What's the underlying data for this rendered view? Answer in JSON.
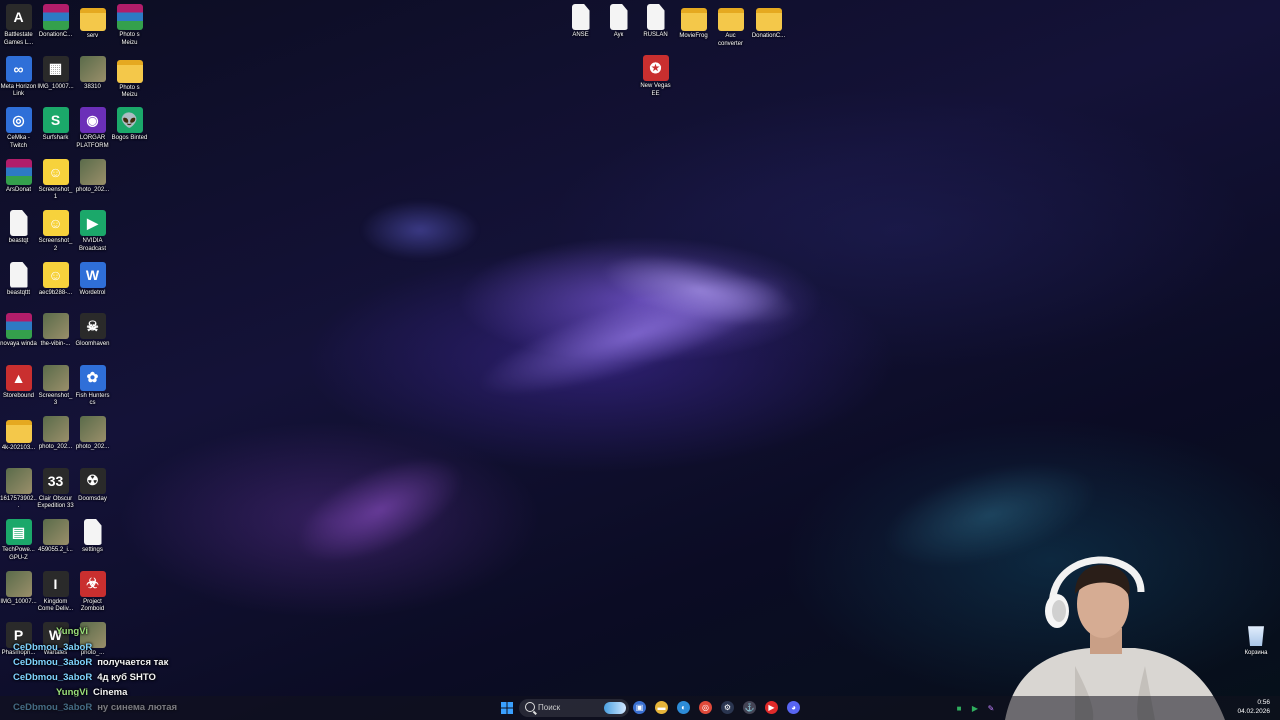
{
  "desktop_icons": {
    "col1": [
      {
        "label": "Battlestate Games L...",
        "icon": "battlestate-icon"
      },
      {
        "label": "Meta Horizon Link",
        "icon": "meta-icon"
      },
      {
        "label": "CeMka - Twitch",
        "icon": "chrome-icon"
      },
      {
        "label": "ArsDonat",
        "icon": "winrar-icon"
      },
      {
        "label": "beastqt",
        "icon": "document-icon"
      },
      {
        "label": "beastqttt",
        "icon": "document-icon"
      },
      {
        "label": "novaya winda",
        "icon": "winrar-icon"
      },
      {
        "label": "Storebound",
        "icon": "storebound-icon"
      },
      {
        "label": "4k-202103...",
        "icon": "folder-icon"
      },
      {
        "label": "1617573902...",
        "icon": "image-icon"
      },
      {
        "label": "TechPowe... GPU-Z",
        "icon": "gpu-z-icon"
      },
      {
        "label": "IMG_10007...",
        "icon": "image-icon"
      },
      {
        "label": "Phasmoph...",
        "icon": "phasmophobia-icon"
      }
    ],
    "col2": [
      {
        "label": "DonationC...",
        "icon": "winrar-icon"
      },
      {
        "label": "IMG_10007...",
        "icon": "qr-image-icon"
      },
      {
        "label": "Surfshark",
        "icon": "surfshark-icon"
      },
      {
        "label": "Screenshot_1",
        "icon": "smile-icon"
      },
      {
        "label": "Screenshot_2",
        "icon": "smile-icon"
      },
      {
        "label": "aec9b288-...",
        "icon": "smile-icon"
      },
      {
        "label": "the-vibin-...",
        "icon": "image-icon"
      },
      {
        "label": "Screenshot_3",
        "icon": "image-icon"
      },
      {
        "label": "photo_202...",
        "icon": "image-icon"
      },
      {
        "label": "Clair Obscur Expedition 33",
        "icon": "clair-obscur-icon"
      },
      {
        "label": "459055.2_i...",
        "icon": "image-icon"
      },
      {
        "label": "Kingdom Come Deliv...",
        "icon": "kingdom-come-icon"
      },
      {
        "label": "Wartales",
        "icon": "wartales-icon"
      }
    ],
    "col3": [
      {
        "label": "serv",
        "icon": "folder-icon"
      },
      {
        "label": "38310",
        "icon": "image-icon"
      },
      {
        "label": "LORGAR PLATFORM",
        "icon": "lorgar-icon"
      },
      {
        "label": "photo_202...",
        "icon": "image-icon"
      },
      {
        "label": "NVIDIA Broadcast",
        "icon": "nvidia-icon"
      },
      {
        "label": "Wordetrol",
        "icon": "word-icon"
      },
      {
        "label": "Gloomhaven",
        "icon": "gloomhaven-icon"
      },
      {
        "label": "Fish Hunters cs",
        "icon": "fish-hunters-icon"
      },
      {
        "label": "photo_202...",
        "icon": "image-icon"
      },
      {
        "label": "Doomsday",
        "icon": "doomsday-icon"
      },
      {
        "label": "settings",
        "icon": "document-icon"
      },
      {
        "label": "Project Zomboid",
        "icon": "zomboid-icon"
      },
      {
        "label": "photo_...",
        "icon": "image-icon"
      }
    ],
    "col4": [
      {
        "label": "Photo s Meizu",
        "icon": "winrar-icon"
      },
      {
        "label": "Photo s Meizu",
        "icon": "folder-icon"
      },
      {
        "label": "Bogos Binted",
        "icon": "alien-icon"
      }
    ],
    "top_row": [
      {
        "label": "ANSE",
        "icon": "document-icon"
      },
      {
        "label": "Аук",
        "icon": "document-icon"
      },
      {
        "label": "RUSLAN",
        "icon": "document-icon"
      },
      {
        "label": "MovieFrog",
        "icon": "folder-icon"
      },
      {
        "label": "Auc converter",
        "icon": "folder-icon"
      },
      {
        "label": "DonationC...",
        "icon": "folder-icon"
      }
    ],
    "new_vegas": {
      "label": "New Vegas EE",
      "icon": "new-vegas-icon"
    },
    "recycle_bin": {
      "label": "Корзина",
      "icon": "recycle-bin-icon"
    }
  },
  "chat": {
    "messages": [
      {
        "user": "YungVi",
        "text": "",
        "color": "#9be07a"
      },
      {
        "user": "CeDbmou_3aboR",
        "text": "",
        "color": "#7fd4ff"
      },
      {
        "user": "CeDbmou_3aboR",
        "text": "получается так",
        "color": "#7fd4ff"
      },
      {
        "user": "CeDbmou_3aboR",
        "text": "4д куб SHTO",
        "color": "#7fd4ff"
      },
      {
        "user": "YungVi",
        "text": "Cinema",
        "color": "#9be07a"
      },
      {
        "user": "CeDbmou_3aboR",
        "text": "ну синема лютая",
        "color": "#7fd4ff"
      }
    ]
  },
  "taskbar": {
    "search_placeholder": "Поиск",
    "apps": [
      "start-icon",
      "widgets-icon",
      "explorer-icon",
      "browser-icon",
      "chrome-icon",
      "steam-icon",
      "anchor-icon",
      "youtube-icon",
      "discord-icon"
    ],
    "tray_icons": [
      "tray-green-icon",
      "tray-play-icon",
      "tray-pen-icon"
    ],
    "time": "0:56",
    "date": "04.02.2026"
  },
  "colors": {
    "chat_user_blue": "#7fd4ff",
    "chat_user_green": "#9be07a",
    "taskbar_bg": "#12121e"
  }
}
